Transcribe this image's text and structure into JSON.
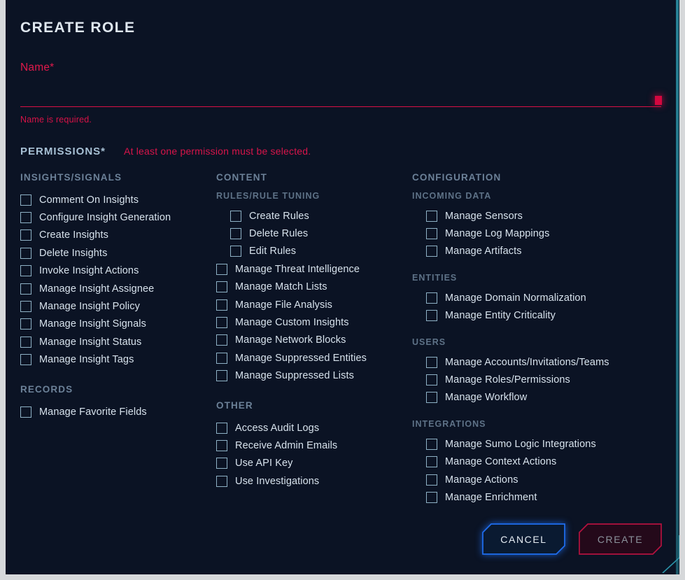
{
  "dialog": {
    "title": "CREATE ROLE",
    "accent_blue": "#1f6ef0",
    "accent_crimson": "#d4073f",
    "accent_teal": "#2b93a8",
    "background": "#0b1324"
  },
  "name_field": {
    "label": "Name*",
    "value": "",
    "placeholder": "",
    "error": "Name is required."
  },
  "permissions": {
    "title": "PERMISSIONS*",
    "error": "At least one permission must be selected.",
    "columns": [
      {
        "name": "column-insights-records",
        "groups": [
          {
            "header": "INSIGHTS/SIGNALS",
            "items": [
              {
                "label": "Comment On Insights",
                "checked": false,
                "indent": false
              },
              {
                "label": "Configure Insight Generation",
                "checked": false,
                "indent": false
              },
              {
                "label": "Create Insights",
                "checked": false,
                "indent": false
              },
              {
                "label": "Delete Insights",
                "checked": false,
                "indent": false
              },
              {
                "label": "Invoke Insight Actions",
                "checked": false,
                "indent": false
              },
              {
                "label": "Manage Insight Assignee",
                "checked": false,
                "indent": false
              },
              {
                "label": "Manage Insight Policy",
                "checked": false,
                "indent": false
              },
              {
                "label": "Manage Insight Signals",
                "checked": false,
                "indent": false
              },
              {
                "label": "Manage Insight Status",
                "checked": false,
                "indent": false
              },
              {
                "label": "Manage Insight Tags",
                "checked": false,
                "indent": false
              }
            ],
            "subgroups": []
          },
          {
            "header": "RECORDS",
            "items": [
              {
                "label": "Manage Favorite Fields",
                "checked": false,
                "indent": false
              }
            ],
            "subgroups": []
          }
        ]
      },
      {
        "name": "column-content-other",
        "groups": [
          {
            "header": "CONTENT",
            "subgroups": [
              {
                "header": "RULES/RULE TUNING",
                "items": [
                  {
                    "label": "Create Rules",
                    "checked": false,
                    "indent": true
                  },
                  {
                    "label": "Delete Rules",
                    "checked": false,
                    "indent": true
                  },
                  {
                    "label": "Edit Rules",
                    "checked": false,
                    "indent": true
                  }
                ]
              }
            ],
            "items": [
              {
                "label": "Manage Threat Intelligence",
                "checked": false,
                "indent": false
              },
              {
                "label": "Manage Match Lists",
                "checked": false,
                "indent": false
              },
              {
                "label": "Manage File Analysis",
                "checked": false,
                "indent": false
              },
              {
                "label": "Manage Custom Insights",
                "checked": false,
                "indent": false
              },
              {
                "label": "Manage Network Blocks",
                "checked": false,
                "indent": false
              },
              {
                "label": "Manage Suppressed Entities",
                "checked": false,
                "indent": false
              },
              {
                "label": "Manage Suppressed Lists",
                "checked": false,
                "indent": false
              }
            ]
          },
          {
            "header": "OTHER",
            "subgroups": [],
            "items": [
              {
                "label": "Access Audit Logs",
                "checked": false,
                "indent": false
              },
              {
                "label": "Receive Admin Emails",
                "checked": false,
                "indent": false
              },
              {
                "label": "Use API Key",
                "checked": false,
                "indent": false
              },
              {
                "label": "Use Investigations",
                "checked": false,
                "indent": false
              }
            ]
          }
        ]
      },
      {
        "name": "column-configuration",
        "groups": [
          {
            "header": "CONFIGURATION",
            "items": [],
            "subgroups": [
              {
                "header": "INCOMING DATA",
                "items": [
                  {
                    "label": "Manage Sensors",
                    "checked": false,
                    "indent": true
                  },
                  {
                    "label": "Manage Log Mappings",
                    "checked": false,
                    "indent": true
                  },
                  {
                    "label": "Manage Artifacts",
                    "checked": false,
                    "indent": true
                  }
                ]
              },
              {
                "header": "ENTITIES",
                "items": [
                  {
                    "label": "Manage Domain Normalization",
                    "checked": false,
                    "indent": true
                  },
                  {
                    "label": "Manage Entity Criticality",
                    "checked": false,
                    "indent": true
                  }
                ]
              },
              {
                "header": "USERS",
                "items": [
                  {
                    "label": "Manage Accounts/Invitations/Teams",
                    "checked": false,
                    "indent": true
                  },
                  {
                    "label": "Manage Roles/Permissions",
                    "checked": false,
                    "indent": true
                  },
                  {
                    "label": "Manage Workflow",
                    "checked": false,
                    "indent": true
                  }
                ]
              },
              {
                "header": "INTEGRATIONS",
                "items": [
                  {
                    "label": "Manage Sumo Logic Integrations",
                    "checked": false,
                    "indent": true
                  },
                  {
                    "label": "Manage Context Actions",
                    "checked": false,
                    "indent": true
                  },
                  {
                    "label": "Manage Actions",
                    "checked": false,
                    "indent": true
                  },
                  {
                    "label": "Manage Enrichment",
                    "checked": false,
                    "indent": true
                  }
                ]
              }
            ]
          }
        ]
      }
    ]
  },
  "footer": {
    "cancel_label": "CANCEL",
    "create_label": "CREATE"
  }
}
